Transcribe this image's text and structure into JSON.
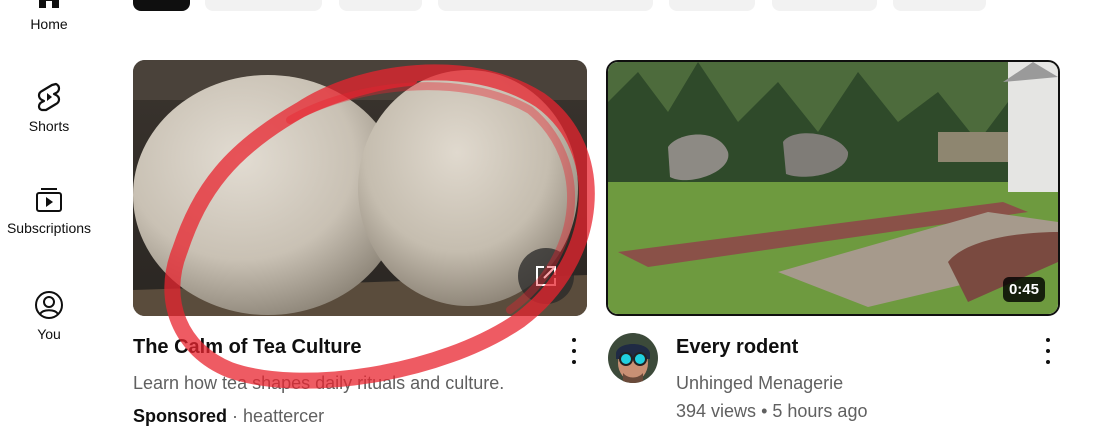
{
  "sidebar": {
    "items": [
      {
        "label": "Home",
        "icon": "home-icon"
      },
      {
        "label": "Shorts",
        "icon": "shorts-icon"
      },
      {
        "label": "Subscriptions",
        "icon": "subscriptions-icon"
      },
      {
        "label": "You",
        "icon": "account-icon"
      }
    ]
  },
  "feed": {
    "ad": {
      "title": "The Calm of Tea Culture",
      "description": "Learn how tea shapes daily rituals and culture.",
      "sponsored_label": "Sponsored",
      "separator": "·",
      "advertiser": "heattercer",
      "external_icon": "external-link-icon"
    },
    "video": {
      "title": "Every rodent",
      "channel": "Unhinged Menagerie",
      "views": "394 views",
      "separator": "•",
      "age": "5 hours ago",
      "duration": "0:45"
    }
  },
  "colors": {
    "annotation_red": "#e8242f",
    "text_primary": "#0f0f0f",
    "text_secondary": "#606060",
    "chip_bg": "#f2f2f2"
  }
}
